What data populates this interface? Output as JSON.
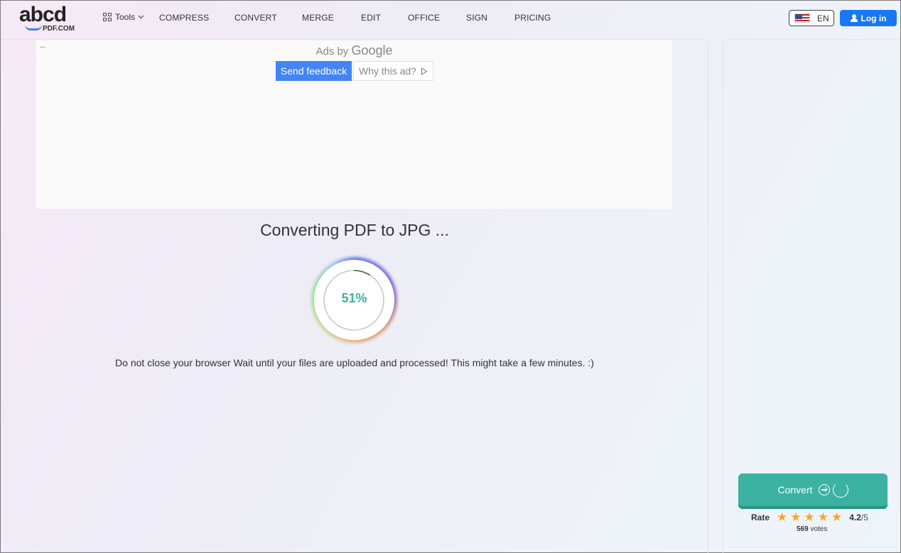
{
  "brand": {
    "logo_main": "abcd",
    "logo_sub": "PDF.COM"
  },
  "nav": {
    "tools_label": "Tools",
    "items": [
      "COMPRESS",
      "CONVERT",
      "MERGE",
      "EDIT",
      "OFFICE",
      "SIGN",
      "PRICING"
    ]
  },
  "language": {
    "code": "EN"
  },
  "login_label": "Log in",
  "ad": {
    "ads_by": "Ads by",
    "google": "Google",
    "send_feedback": "Send feedback",
    "why_this_ad": "Why this ad?"
  },
  "status": {
    "title": "Converting PDF to JPG ...",
    "progress_percent": 51,
    "progress_label": "51%",
    "notice": "Do not close your browser Wait until your files are uploaded and processed! This might take a few minutes. :)"
  },
  "sidebar": {
    "convert_label": "Convert",
    "rate_label": "Rate",
    "rating": "4.2",
    "rating_max": "/5",
    "stars": 5,
    "votes_count": "569",
    "votes_label": "votes"
  },
  "colors": {
    "accent": "#3bb2a2",
    "primary": "#1877f2",
    "star": "#f5a52a"
  }
}
